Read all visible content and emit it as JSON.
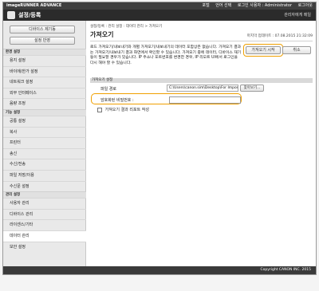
{
  "topbar": {
    "brand": "imageRUNNER ADVANCE",
    "links": [
      "포털",
      "언어 선택",
      "로그인 사용자 : Administrator",
      "로그아웃"
    ]
  },
  "header": {
    "title": "설정/등록",
    "right_link": "관리자에게 메일"
  },
  "sidebar": {
    "device_button": "디바이스 제기동",
    "apply_button": "설정 반영",
    "sections": [
      {
        "heading": "환경 설정",
        "items": [
          "용지 설정",
          "바이에/한가 설정",
          "네트워크 설정",
          "외부 인터페이스",
          "음량 조정"
        ]
      },
      {
        "heading": "기능 설정",
        "items": [
          "공통 설정",
          "복사",
          "프린터",
          "송신",
          "수신/전송",
          "파일 저장/이용",
          "수신문 설정"
        ]
      },
      {
        "heading": "관리 설정",
        "items": [
          "사용자 관리",
          "디바이스 관리",
          "라이센스/기타",
          "데이터 관리",
          "보안 설정"
        ]
      }
    ],
    "active_item": "데이터 관리"
  },
  "main": {
    "breadcrumb": "설정/등록 : 관리 설정 : 데이터 관리 > 가져오기",
    "title": "가져오기",
    "last_updated": "마지막 업데이트 : 07.08.2015 21:32:09",
    "description": "로드 가져오기/내보내기와 개별 가져오기/내보내기의 데이터 포함상은 없습니다. 가져오기 결과는 가져오기/내보내기 결과 화면에서 확인할 수 있습니다. 가져오기 중에 데이터, 디바이스 재기동이 필요할 경우가 있습니다. IP 주소나 포트번호를 변경한 경우, IP 리모트 UI에서 로그인을 다시 해야 할 수 있습니다.",
    "start_button": "가져오기 시작",
    "cancel_button": "취소",
    "section_title": "가져오기 설정",
    "file_path_label": "파일 경로",
    "file_path_value": "C:\\Users\\canon.sim\\Desktop\\For Import\\fl",
    "browse_button": "찾아보기...",
    "password_label": "암호화된 비밀번호 :",
    "password_value": "",
    "checkbox_label": "가져오기 결과 리포트 작성"
  },
  "footer": {
    "copyright": "Copyright CANON INC. 2015"
  }
}
